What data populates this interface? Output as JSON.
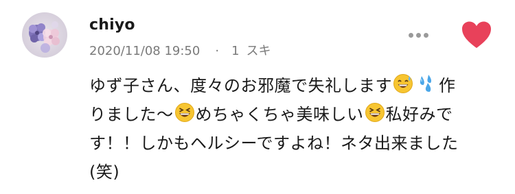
{
  "comment": {
    "author": "chiyo",
    "timestamp": "2020/11/08 19:50",
    "separator": "·",
    "likes_count": "1",
    "likes_label": "スキ",
    "like_icon": "heart-icon",
    "like_color": "#e8415a",
    "more_icon": "more-dots-icon",
    "body_lines": [
      {
        "a": "ゆず子さん、度々のお邪魔で失礼します",
        "b": "作"
      },
      {
        "a": "りました〜",
        "b": "めちゃくちゃ美味しい",
        "c": "私好みで"
      },
      {
        "a": "す！！しかもヘルシーですよね！ネタ出来ました"
      },
      {
        "a": "(笑)"
      }
    ],
    "emoji_names": [
      "sweat-smile-emoji",
      "sweat-droplets-emoji",
      "laughing-emoji",
      "laughing-emoji"
    ]
  }
}
